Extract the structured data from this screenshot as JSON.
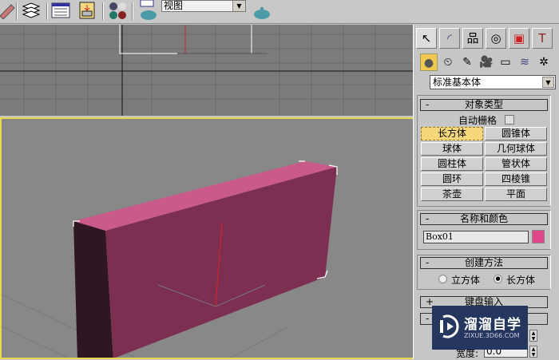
{
  "toolbar": {
    "view_combo": "视图",
    "icons": [
      "pencil-icon",
      "layers-icon",
      "track-view-icon",
      "schematic-icon",
      "material-editor-icon",
      "render-scene-icon",
      "quick-render-icon"
    ]
  },
  "panel": {
    "tabs": [
      "create-tab",
      "modify-tab",
      "hierarchy-tab",
      "motion-tab",
      "display-tab",
      "utilities-tab"
    ],
    "subtabs": [
      "geometry",
      "shapes",
      "lights",
      "cameras",
      "helpers",
      "space-warps",
      "systems"
    ],
    "category": "标准基本体",
    "object_type": {
      "title": "对象类型",
      "autogrid": "自动栅格",
      "buttons": [
        "长方体",
        "圆锥体",
        "球体",
        "几何球体",
        "圆柱体",
        "管状体",
        "圆环",
        "四棱锥",
        "茶壶",
        "平面"
      ],
      "active": "长方体"
    },
    "name_color": {
      "title": "名称和颜色",
      "name": "Box01",
      "color": "#e0468a"
    },
    "creation_method": {
      "title": "创建方法",
      "options": [
        "立方体",
        "长方体"
      ],
      "selected": "长方体"
    },
    "keyboard_entry": {
      "title": "键盘输入"
    },
    "parameters": {
      "width_label": "宽度:",
      "width_value": "0.0"
    }
  },
  "watermark": {
    "name": "溜溜自学",
    "url": "ZIXUE.3D66.COM"
  }
}
